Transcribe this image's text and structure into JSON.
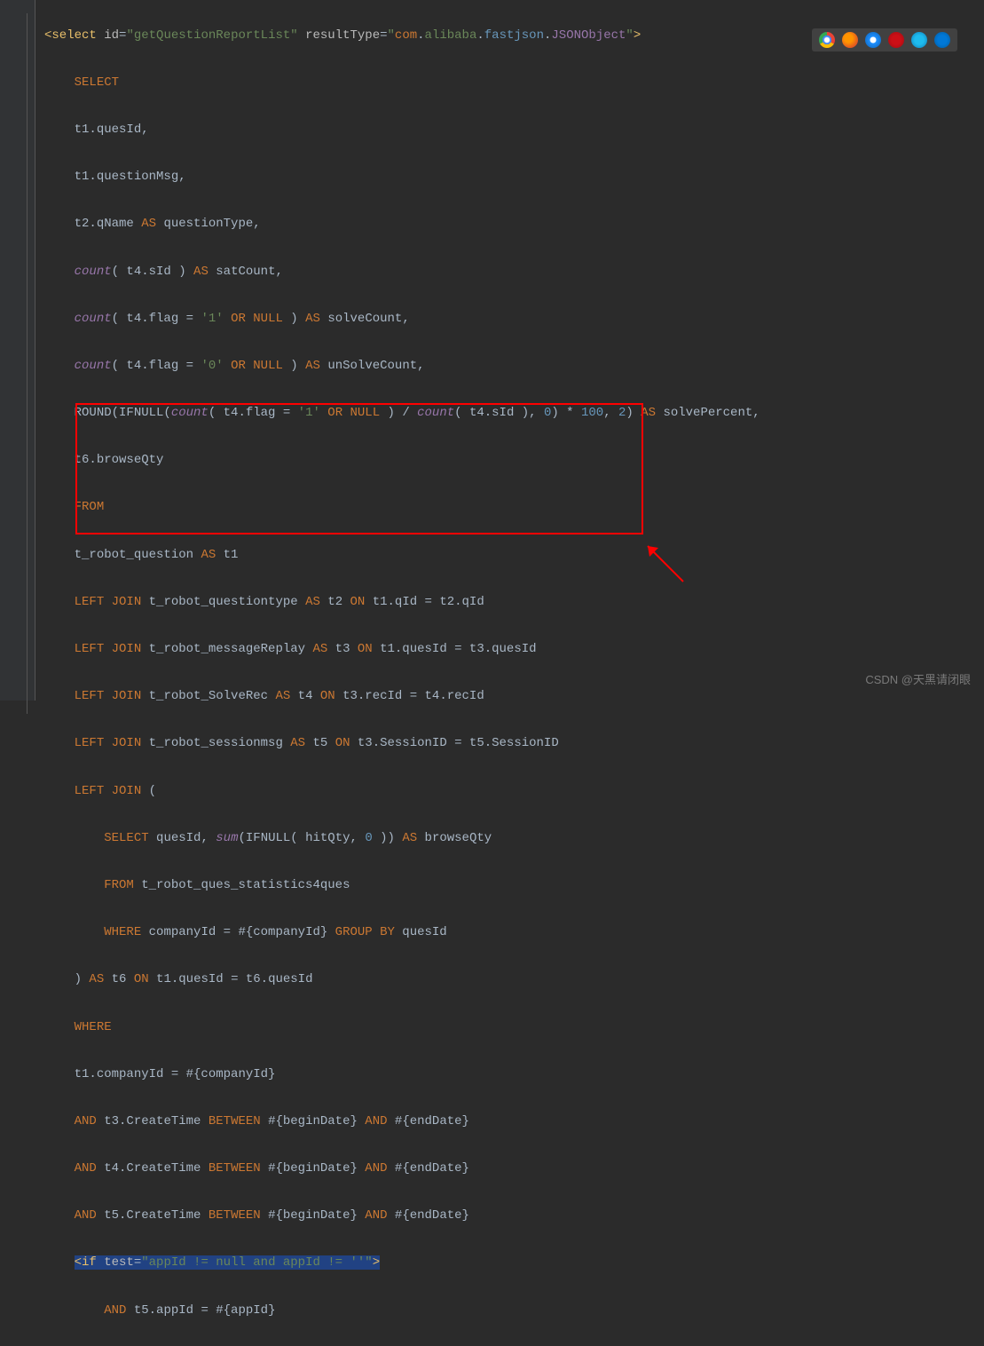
{
  "xml_open": {
    "tag": "select",
    "id_attr": "id",
    "id_val": "\"getQuestionReportList\"",
    "result_attr": "resultType",
    "result_val_prefix": "\"",
    "ns": [
      "com",
      ".",
      "alibaba",
      ".",
      "fastjson",
      ".",
      "JSONObject"
    ],
    "result_val_suffix": "\""
  },
  "lines": {
    "l1": "SELECT",
    "l2": "t1.quesId,",
    "l3": "t1.questionMsg,",
    "l4_a": "t2.qName ",
    "l4_b": "AS",
    "l4_c": " questionType,",
    "l5_a": "count",
    "l5_b": "( t4.sId ) ",
    "l5_c": "AS",
    "l5_d": " satCount,",
    "l6_a": "count",
    "l6_b": "( t4.flag = ",
    "l6_c": "'1'",
    "l6_d": " OR NULL",
    "l6_e": " ) ",
    "l6_f": "AS",
    "l6_g": " solveCount,",
    "l7_a": "count",
    "l7_b": "( t4.flag = ",
    "l7_c": "'0'",
    "l7_d": " OR NULL",
    "l7_e": " ) ",
    "l7_f": "AS",
    "l7_g": " unSolveCount,",
    "l8_a": "ROUND(IFNULL(",
    "l8_b": "count",
    "l8_c": "( t4.flag = ",
    "l8_d": "'1'",
    "l8_e": " OR NULL",
    "l8_f": " ) / ",
    "l8_g": "count",
    "l8_h": "( t4.sId ), ",
    "l8_i": "0",
    "l8_j": ") * ",
    "l8_k": "100",
    "l8_l": ", ",
    "l8_m": "2",
    "l8_n": ") ",
    "l8_o": "AS",
    "l8_p": " solvePercent,",
    "l9": "t6.browseQty",
    "l10": "FROM",
    "l11_a": "t_robot_question ",
    "l11_b": "AS",
    "l11_c": " t1",
    "l12_a": "LEFT JOIN",
    "l12_b": " t_robot_questiontype ",
    "l12_c": "AS",
    "l12_d": " t2 ",
    "l12_e": "ON",
    "l12_f": " t1.qId = t2.qId",
    "l13_a": "LEFT JOIN",
    "l13_b": " t_robot_messageReplay ",
    "l13_c": "AS",
    "l13_d": " t3 ",
    "l13_e": "ON",
    "l13_f": " t1.quesId = t3.quesId",
    "l14_a": "LEFT JOIN",
    "l14_b": " t_robot_SolveRec ",
    "l14_c": "AS",
    "l14_d": " t4 ",
    "l14_e": "ON",
    "l14_f": " t3.recId = t4.recId",
    "l15_a": "LEFT JOIN",
    "l15_b": " t_robot_sessionmsg ",
    "l15_c": "AS",
    "l15_d": " t5 ",
    "l15_e": "ON",
    "l15_f": " t3.SessionID = t5.SessionID",
    "l16_a": "LEFT JOIN",
    "l16_b": " (",
    "l17_a": "SELECT",
    "l17_b": " quesId, ",
    "l17_c": "sum",
    "l17_d": "(IFNULL( hitQty, ",
    "l17_e": "0",
    "l17_f": " )) ",
    "l17_g": "AS",
    "l17_h": " browseQty",
    "l18_a": "FROM",
    "l18_b": " t_robot_ques_statistics4ques",
    "l19_a": "WHERE",
    "l19_b": " companyId = #{companyId} ",
    "l19_c": "GROUP BY",
    "l19_d": " quesId",
    "l20_a": ") ",
    "l20_b": "AS",
    "l20_c": " t6 ",
    "l20_d": "ON",
    "l20_e": " t1.quesId = t6.quesId",
    "l21": "WHERE",
    "l22": "t1.companyId = #{companyId}",
    "l23_a": "AND",
    "l23_b": " t3.CreateTime ",
    "l23_c": "BETWEEN",
    "l23_d": " #{beginDate} ",
    "l23_e": "AND",
    "l23_f": " #{endDate}",
    "l24_a": "AND",
    "l24_b": " t4.CreateTime ",
    "l24_c": "BETWEEN",
    "l24_d": " #{beginDate} ",
    "l24_e": "AND",
    "l24_f": " #{endDate}",
    "l25_a": "AND",
    "l25_b": " t5.CreateTime ",
    "l25_c": "BETWEEN",
    "l25_d": " #{beginDate} ",
    "l25_e": "AND",
    "l25_f": " #{endDate}",
    "if_tag": "if",
    "if_attr": "test",
    "if_val": "\"appId != null and appId != ''\"",
    "l27_a": "AND",
    "l27_b": " t5.appId = #{appId}"
  },
  "watermark": "CSDN @天黑请闭眼",
  "icons": [
    "chrome",
    "firefox",
    "safari",
    "opera",
    "ie",
    "edge"
  ]
}
